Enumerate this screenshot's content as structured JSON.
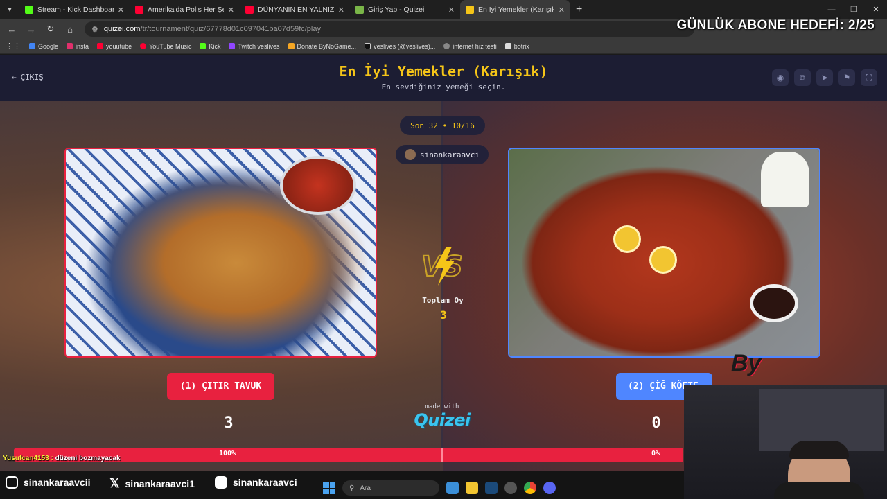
{
  "browser": {
    "tabs": [
      {
        "title": "Stream - Kick Dashboard",
        "color": "#53fc18",
        "active": false
      },
      {
        "title": "Amerika'da Polis Her Şeyi Görüy",
        "color": "#ff0033",
        "active": false
      },
      {
        "title": "DÜNYANIN EN YALNIZ EVİNDE",
        "color": "#ff0033",
        "active": false
      },
      {
        "title": "Giriş Yap - Quizei",
        "color": "#7ab648",
        "active": false
      },
      {
        "title": "En İyi Yemekler (Karışık) - Tier L",
        "color": "#f5c518",
        "active": true
      }
    ],
    "url_host": "quizei.com",
    "url_path": "/tr/tournament/quiz/67778d01c097041ba07d59fc/play",
    "bookmarks": [
      "Google",
      "insta",
      "youutube",
      "YouTube Music",
      "Kick",
      "Twitch veslives",
      "Donate ByNoGame...",
      "veslives (@veslives)...",
      "internet hız testi",
      "botrix"
    ]
  },
  "overlay": {
    "sub_goal": "GÜNLÜK ABONE HEDEFİ: 2/25",
    "by_logo": "By"
  },
  "quiz": {
    "back_label": "ÇIKIŞ",
    "title": "En İyi Yemekler (Karışık)",
    "subtitle": "En sevdiğiniz yemeği seçin.",
    "round": "Son 32 • 10/16",
    "username": "sinankaraavci",
    "total_votes_label": "Toplam Oy",
    "total_votes": "3",
    "left": {
      "label": "(1) ÇITIR TAVUK",
      "score": "3",
      "percent": "100%",
      "percent_value": 100
    },
    "right": {
      "label": "(2) ÇİĞ KÖFTE",
      "score": "0",
      "percent": "0%",
      "percent_value": 0
    },
    "made_with": "made with",
    "brand": "Quizei"
  },
  "chat": {
    "user": "Yusufcan4153 :",
    "message": "düzeni bozmayacak"
  },
  "socials": [
    {
      "icon": "instagram-icon",
      "handle": "sinankaraavcii"
    },
    {
      "icon": "x-icon",
      "handle": "sinankaraavci1"
    },
    {
      "icon": "youtube-icon",
      "handle": "sinankaraavci"
    }
  ],
  "taskbar": {
    "search_placeholder": "Ara"
  },
  "colors": {
    "accent": "#f5c518",
    "left": "#e8213f",
    "right": "#4f86ff",
    "header_bg": "#1c1d33"
  }
}
